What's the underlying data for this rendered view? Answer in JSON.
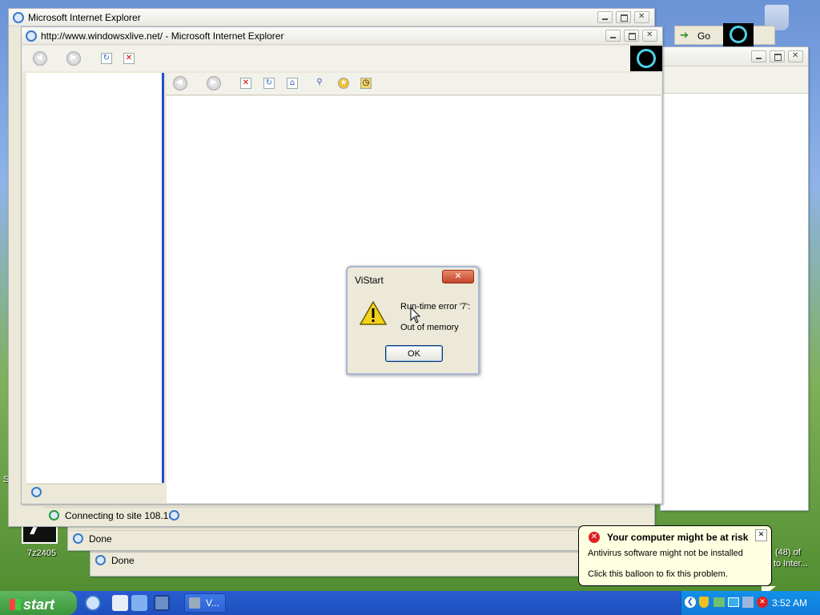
{
  "windows": {
    "back_title": "Microsoft Internet Explorer",
    "front_title": "http://www.windowsxlive.net/ - Microsoft Internet Explorer",
    "address_go": "Go"
  },
  "status": {
    "connecting": "Connecting to site 108.16",
    "done1": "Done",
    "done2": "Done"
  },
  "dialog": {
    "title": "ViStart",
    "close": "✕",
    "message1": "Run-time error '7':",
    "message2": "Out of memory",
    "ok": "OK"
  },
  "desktop": {
    "seven_zip_label": "7z2405",
    "partial_label": "Sho",
    "right_text1": "(48) of",
    "right_text2": "to Inter..."
  },
  "balloon": {
    "title": "Your computer might be at risk",
    "line1": "Antivirus software might not be installed",
    "line2": "Click this balloon to fix this problem.",
    "close": "✕"
  },
  "taskbar": {
    "start": "start",
    "task_label": "V...",
    "clock": "3:52 AM"
  }
}
